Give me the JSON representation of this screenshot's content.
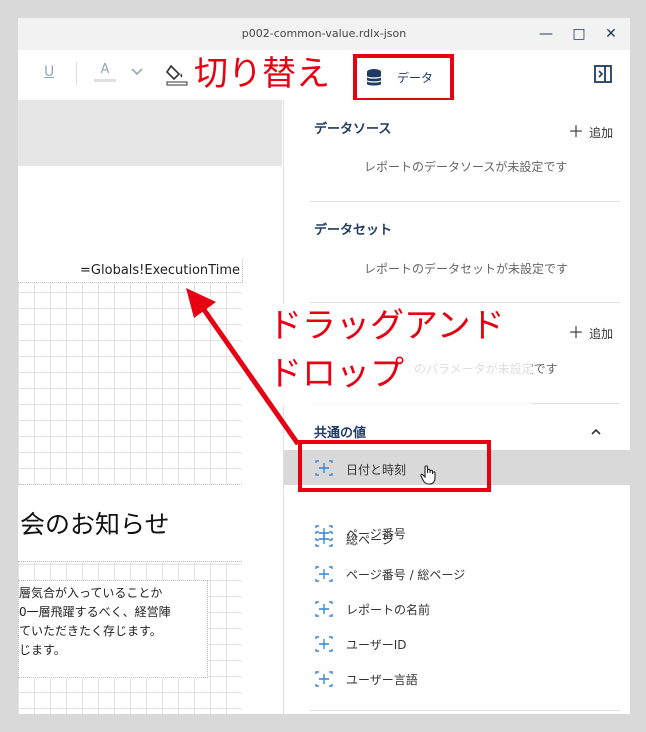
{
  "window": {
    "title": "p002-common-value.rdlx-json",
    "minimize_glyph": "—",
    "maximize_glyph": "□",
    "close_glyph": "✕"
  },
  "toolbar": {
    "underline_label": "U",
    "font_color_label": "A",
    "data_button_label": "データ"
  },
  "report": {
    "expression_text": "=Globals!ExecutionTime",
    "heading_text": "会のお知らせ",
    "body_lines": [
      "層気合が入っていることか",
      "0一層飛躍するべく、経営陣",
      "ていただきたく存じます。",
      "じます。"
    ]
  },
  "panel": {
    "datasource": {
      "title": "データソース",
      "add_label": "追加",
      "empty_text": "レポートのデータソースが未設定です"
    },
    "dataset": {
      "title": "データセット",
      "empty_text": "レポートのデータセットが未設定です"
    },
    "parameters": {
      "add_label": "追加",
      "empty_text": "のパラメータが未設定です"
    },
    "common_values": {
      "title": "共通の値",
      "items": [
        {
          "label": "日付と時刻"
        },
        {
          "label": "ページ番号"
        },
        {
          "label": "総ページ"
        },
        {
          "label": "ページ番号 / 総ページ"
        },
        {
          "label": "レポートの名前"
        },
        {
          "label": "ユーザーID"
        },
        {
          "label": "ユーザー言語"
        }
      ]
    }
  },
  "annotations": {
    "switch_label": "切り替え",
    "drag_label_line1": "ドラッグアンド",
    "drag_label_line2": "ドロップ"
  },
  "colors": {
    "accent": "#1f3b63",
    "annotation_red": "#e60012",
    "selected_row": "#d9d9d9"
  }
}
